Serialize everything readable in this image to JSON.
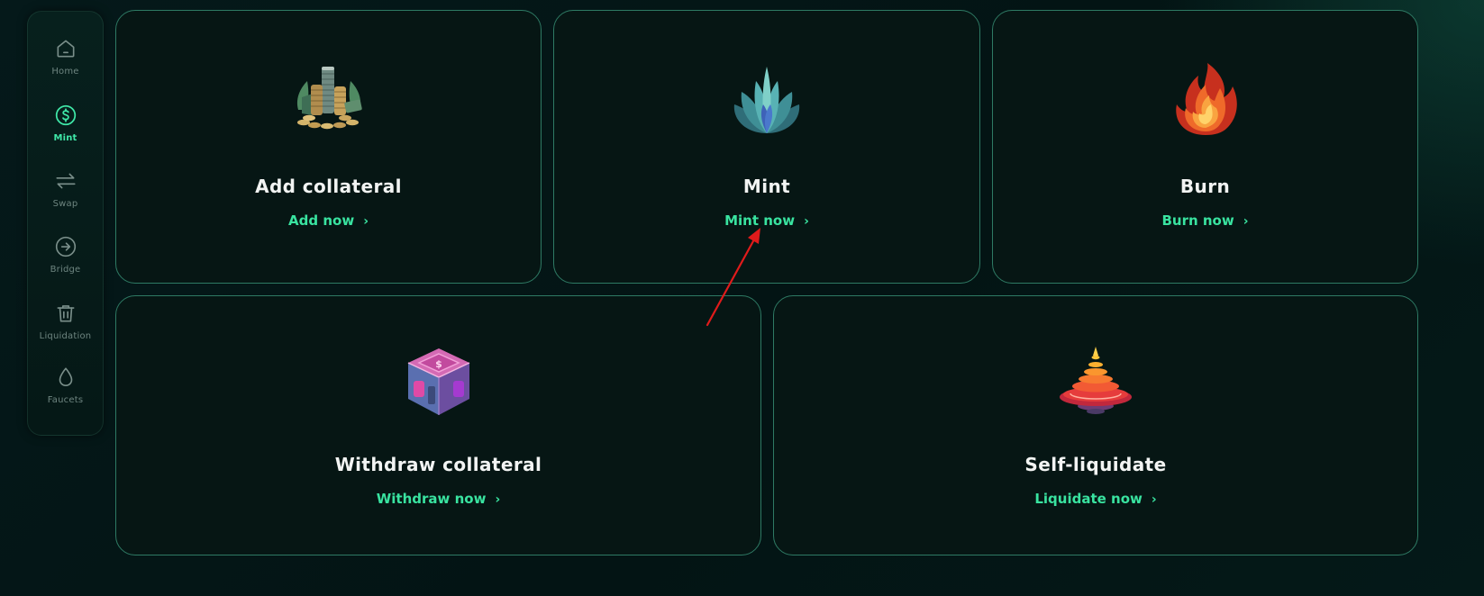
{
  "sidebar": {
    "items": [
      {
        "label": "Home",
        "icon": "home-icon",
        "active": false
      },
      {
        "label": "Mint",
        "icon": "dollar-circle-icon",
        "active": true
      },
      {
        "label": "Swap",
        "icon": "swap-arrows-icon",
        "active": false
      },
      {
        "label": "Bridge",
        "icon": "arrow-right-circle-icon",
        "active": false
      },
      {
        "label": "Liquidation",
        "icon": "trash-icon",
        "active": false
      },
      {
        "label": "Faucets",
        "icon": "droplet-icon",
        "active": false
      }
    ]
  },
  "cards": [
    {
      "title": "Add collateral",
      "action": "Add now",
      "chevron": "›",
      "art": "coins-stack-image"
    },
    {
      "title": "Mint",
      "action": "Mint now",
      "chevron": "›",
      "art": "lotus-image"
    },
    {
      "title": "Burn",
      "action": "Burn now",
      "chevron": "›",
      "art": "flame-image"
    },
    {
      "title": "Withdraw collateral",
      "action": "Withdraw now",
      "chevron": "›",
      "art": "cube-vault-image"
    },
    {
      "title": "Self-liquidate",
      "action": "Liquidate now",
      "chevron": "›",
      "art": "spinning-top-image"
    }
  ],
  "colors": {
    "background": "#041716",
    "card_border": "#2e7a64",
    "accent": "#39e3a0",
    "annotation_arrow": "#e01b1b"
  }
}
